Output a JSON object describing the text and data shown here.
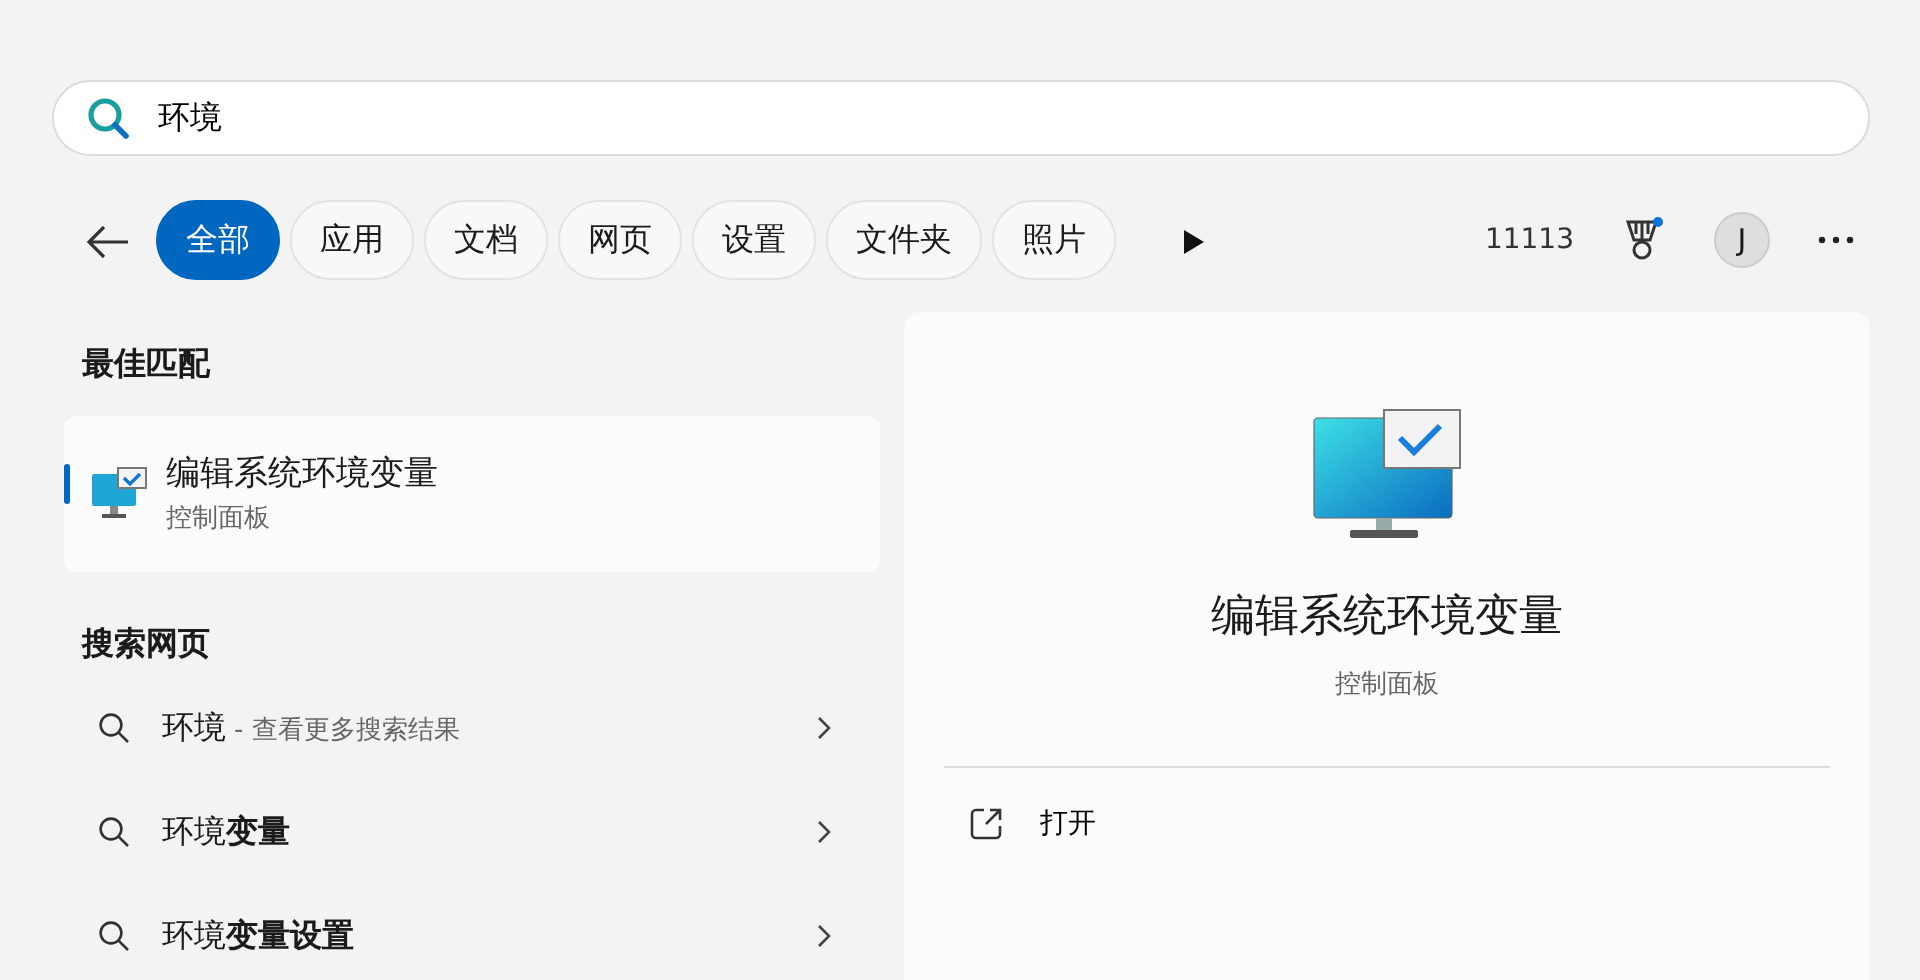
{
  "search": {
    "value": "环境"
  },
  "filters": [
    {
      "label": "全部",
      "selected": true
    },
    {
      "label": "应用",
      "selected": false
    },
    {
      "label": "文档",
      "selected": false
    },
    {
      "label": "网页",
      "selected": false
    },
    {
      "label": "设置",
      "selected": false
    },
    {
      "label": "文件夹",
      "selected": false
    },
    {
      "label": "照片",
      "selected": false
    }
  ],
  "points": "11113",
  "avatar": "J",
  "best_match": {
    "heading": "最佳匹配",
    "title": "编辑系统环境变量",
    "subtitle": "控制面板",
    "selected": true
  },
  "web": {
    "heading": "搜索网页",
    "items": [
      {
        "text": "环境",
        "hint": "- 查看更多搜索结果"
      },
      {
        "text": "环境**变量**"
      },
      {
        "text": "环境**变量设置**"
      }
    ]
  },
  "detail": {
    "title": "编辑系统环境变量",
    "subtitle": "控制面板",
    "actions": [
      {
        "label": "打开"
      }
    ]
  }
}
